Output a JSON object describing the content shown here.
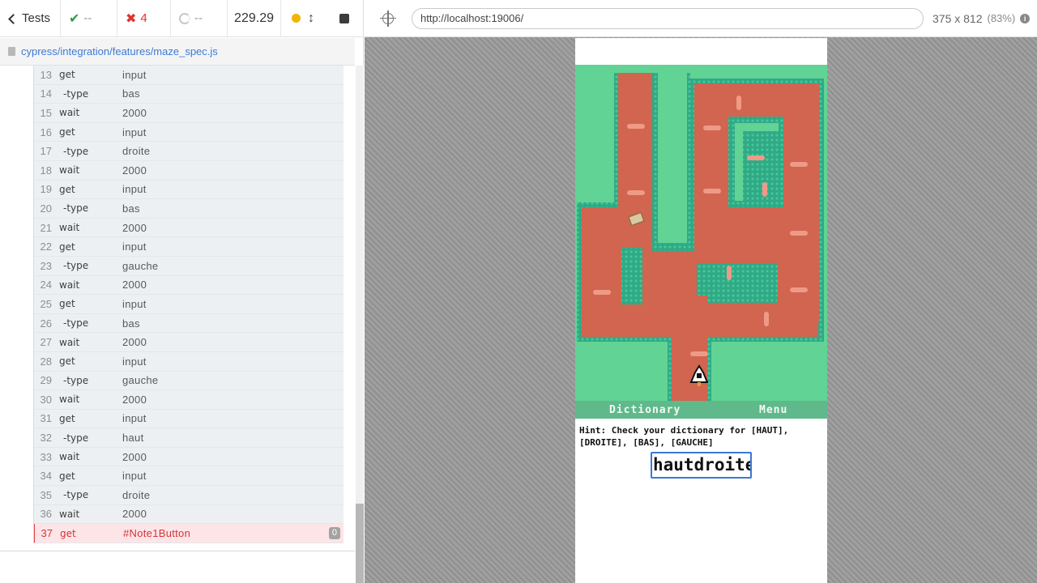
{
  "stats": {
    "tests_label": "Tests",
    "passed": "--",
    "failed": "4",
    "pending": "--",
    "duration": "229.29"
  },
  "spec": {
    "path": "cypress/integration/features/maze_spec.js"
  },
  "commands": [
    {
      "num": "13",
      "name": "get",
      "arg": "input",
      "child": false
    },
    {
      "num": "14",
      "name": "-type",
      "arg": "bas",
      "child": true
    },
    {
      "num": "15",
      "name": "wait",
      "arg": "2000",
      "child": false
    },
    {
      "num": "16",
      "name": "get",
      "arg": "input",
      "child": false
    },
    {
      "num": "17",
      "name": "-type",
      "arg": "droite",
      "child": true
    },
    {
      "num": "18",
      "name": "wait",
      "arg": "2000",
      "child": false
    },
    {
      "num": "19",
      "name": "get",
      "arg": "input",
      "child": false
    },
    {
      "num": "20",
      "name": "-type",
      "arg": "bas",
      "child": true
    },
    {
      "num": "21",
      "name": "wait",
      "arg": "2000",
      "child": false
    },
    {
      "num": "22",
      "name": "get",
      "arg": "input",
      "child": false
    },
    {
      "num": "23",
      "name": "-type",
      "arg": "gauche",
      "child": true
    },
    {
      "num": "24",
      "name": "wait",
      "arg": "2000",
      "child": false
    },
    {
      "num": "25",
      "name": "get",
      "arg": "input",
      "child": false
    },
    {
      "num": "26",
      "name": "-type",
      "arg": "bas",
      "child": true
    },
    {
      "num": "27",
      "name": "wait",
      "arg": "2000",
      "child": false
    },
    {
      "num": "28",
      "name": "get",
      "arg": "input",
      "child": false
    },
    {
      "num": "29",
      "name": "-type",
      "arg": "gauche",
      "child": true
    },
    {
      "num": "30",
      "name": "wait",
      "arg": "2000",
      "child": false
    },
    {
      "num": "31",
      "name": "get",
      "arg": "input",
      "child": false
    },
    {
      "num": "32",
      "name": "-type",
      "arg": "haut",
      "child": true
    },
    {
      "num": "33",
      "name": "wait",
      "arg": "2000",
      "child": false
    },
    {
      "num": "34",
      "name": "get",
      "arg": "input",
      "child": false
    },
    {
      "num": "35",
      "name": "-type",
      "arg": "droite",
      "child": true
    },
    {
      "num": "36",
      "name": "wait",
      "arg": "2000",
      "child": false
    },
    {
      "num": "37",
      "name": "get",
      "arg": "#Note1Button",
      "child": false,
      "failed": true,
      "badge": "0"
    }
  ],
  "browser": {
    "url": "http://localhost:19006/",
    "viewport": "375 x 812",
    "scale": "(83%)"
  },
  "app": {
    "menu_dictionary": "Dictionary",
    "menu_menu": "Menu",
    "hint": "Hint: Check your dictionary for [HAUT], [DROITE], [BAS], [GAUCHE]",
    "answer_value": "hautdroite"
  },
  "colors": {
    "grass": "#61d394",
    "path": "#d1654f",
    "hedge": "#2fa986",
    "menu_bar": "#5fb98a",
    "fail": "#e3312f",
    "pass": "#2e9b47",
    "link": "#3b7bd4"
  }
}
